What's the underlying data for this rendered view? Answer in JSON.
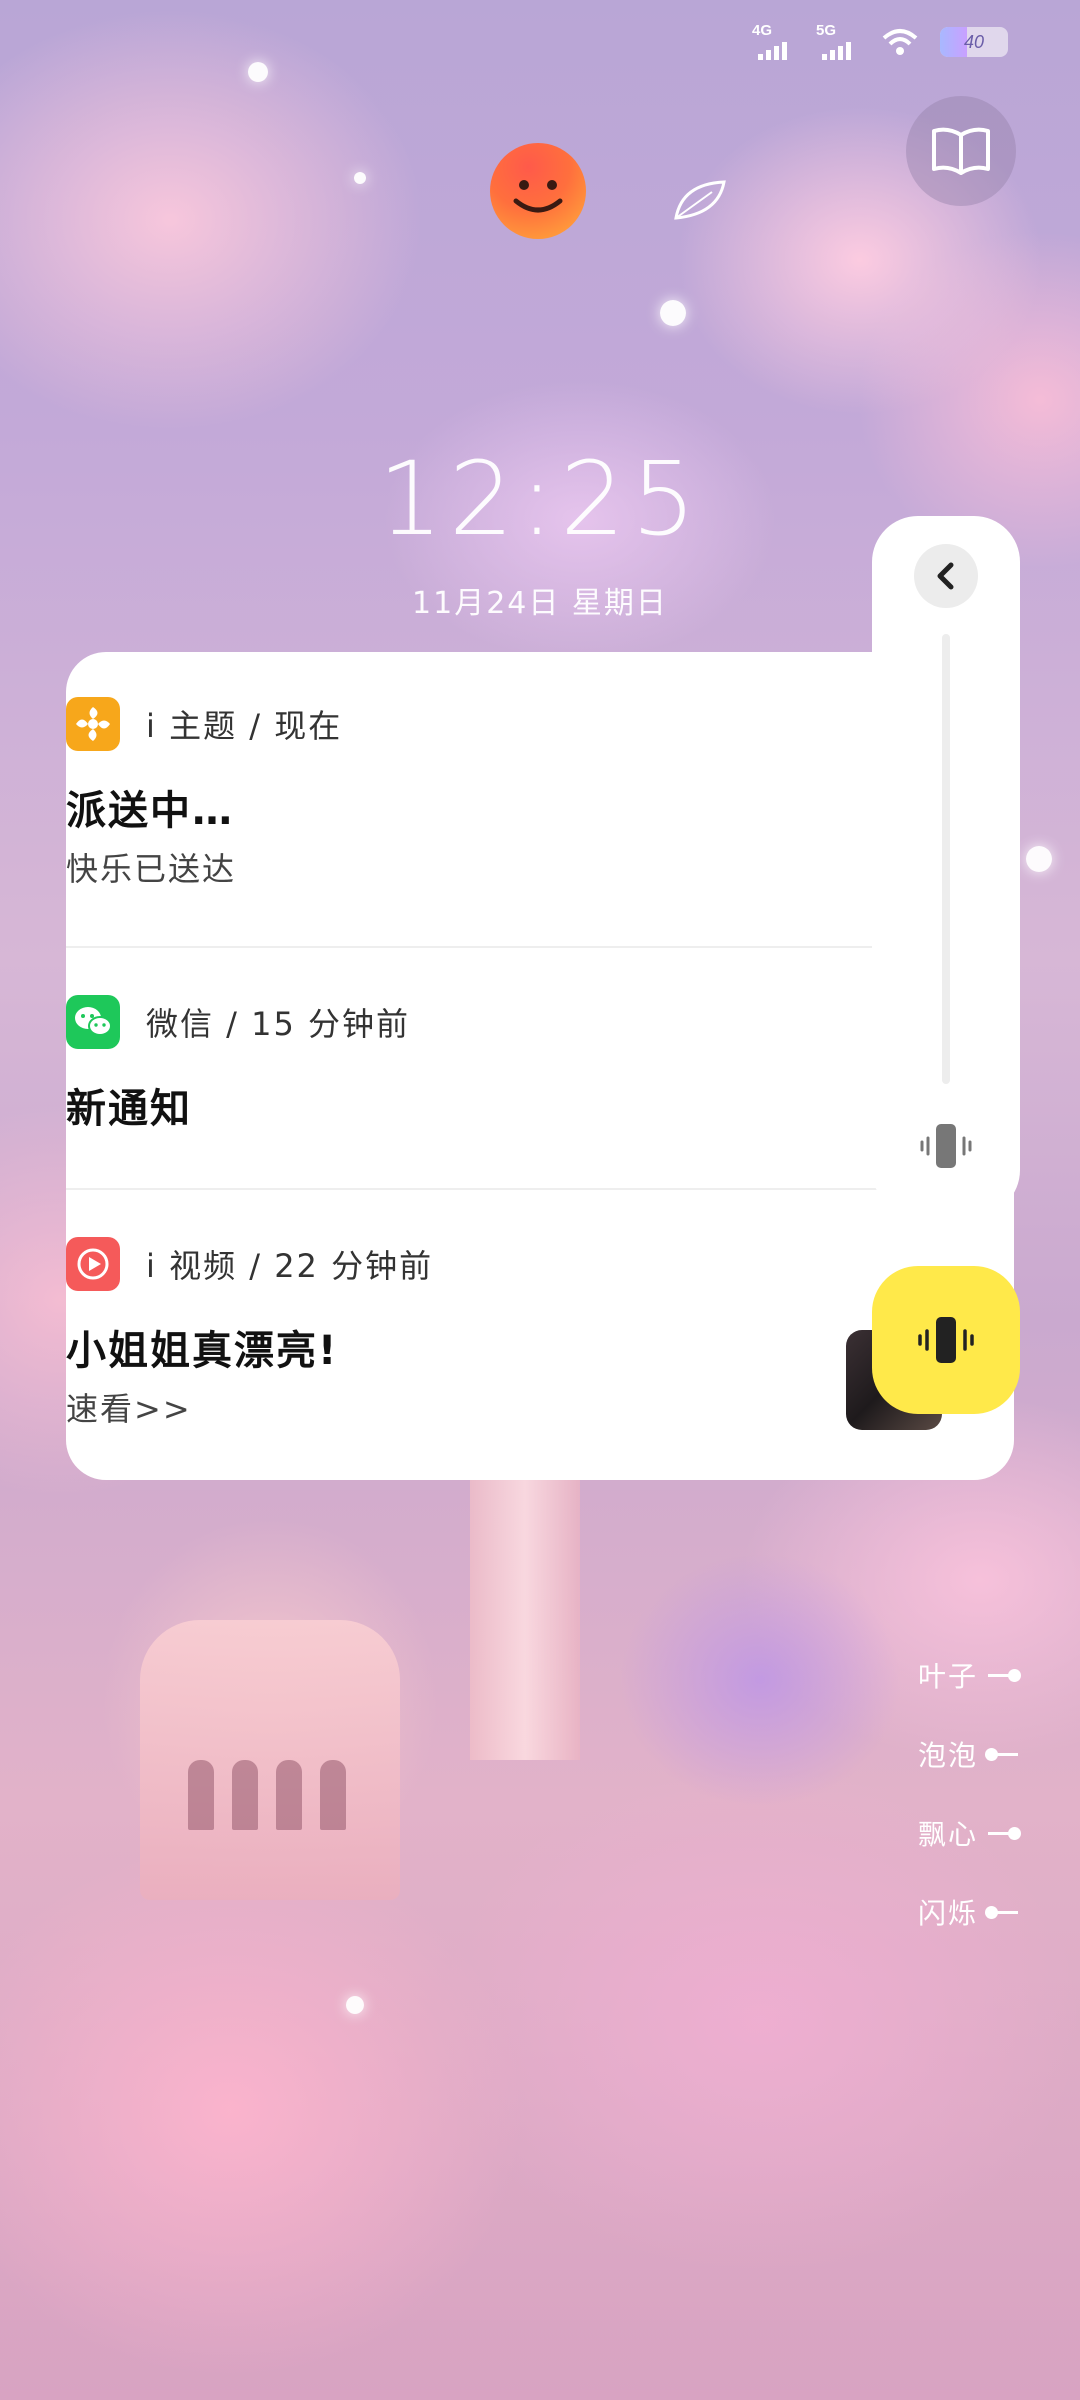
{
  "status_bar": {
    "net1": "4G",
    "net2": "5G",
    "battery": "40",
    "battery_level": 0.4
  },
  "lockscreen": {
    "time": "12:25",
    "date": "11月24日  星期日"
  },
  "notifications": [
    {
      "app": "i 主题 / 现在",
      "title": "派送中…",
      "body": "快乐已送达",
      "icon": "theme-icon",
      "color": "#f7a71b"
    },
    {
      "app": "微信 / 15 分钟前",
      "title": "新通知",
      "body": "",
      "icon": "wechat-icon",
      "color": "#1ec85a"
    },
    {
      "app": "i 视频 / 22 分钟前",
      "title": "小姐姐真漂亮!",
      "body": "速看>>",
      "icon": "video-play-icon",
      "color": "#f55a5a"
    }
  ],
  "effects": [
    "叶子",
    "泡泡",
    "飘心",
    "闪烁"
  ],
  "colors": {
    "vibrate_button": "#ffe94a",
    "panel": "#ffffff"
  }
}
